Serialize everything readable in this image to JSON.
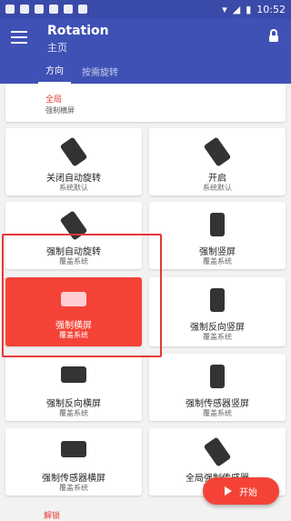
{
  "status": {
    "time": "10:52"
  },
  "appbar": {
    "title": "Rotation",
    "subtitle": "主页"
  },
  "tabs": [
    {
      "label": "方向"
    },
    {
      "label": "按需旋转"
    }
  ],
  "global": {
    "title": "全局",
    "value": "强制横屏"
  },
  "cards": [
    {
      "title": "关闭自动旋转",
      "sub": "系统默认"
    },
    {
      "title": "开启",
      "sub": "系统默认"
    },
    {
      "title": "强制自动旋转",
      "sub": "覆盖系统"
    },
    {
      "title": "强制竖屏",
      "sub": "覆盖系统"
    },
    {
      "title": "强制横屏",
      "sub": "覆盖系统"
    },
    {
      "title": "强制反向竖屏",
      "sub": "覆盖系统"
    },
    {
      "title": "强制反向横屏",
      "sub": "覆盖系统"
    },
    {
      "title": "强制传感器竖屏",
      "sub": "覆盖系统"
    },
    {
      "title": "强制传感器横屏",
      "sub": "覆盖系统"
    },
    {
      "title": "全局强制传感器",
      "sub": "覆盖系统"
    }
  ],
  "fab": {
    "label": "开始"
  },
  "bottom": {
    "label": "解锁"
  },
  "colors": {
    "primary": "#3f51b5",
    "accent": "#f44336"
  }
}
